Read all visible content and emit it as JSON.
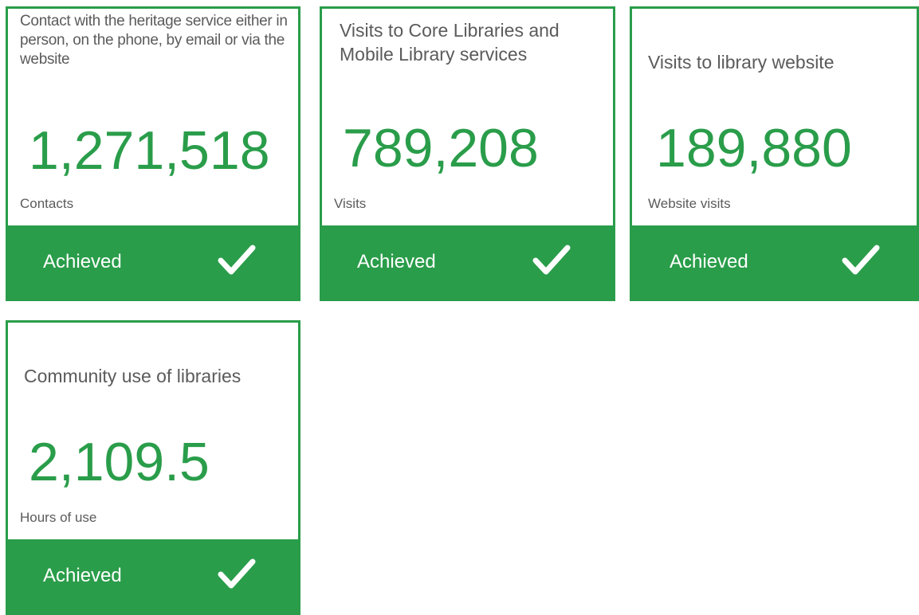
{
  "cards": [
    {
      "title": "Contact with the heritage service either in person, on the phone, by email or via the website",
      "value": "1,271,518",
      "unit": "Contacts",
      "status": "Achieved",
      "status_icon": "check-icon"
    },
    {
      "title": "Visits to Core Libraries and Mobile Library services",
      "value": "789,208",
      "unit": "Visits",
      "status": "Achieved",
      "status_icon": "check-icon"
    },
    {
      "title": "Visits to library website",
      "value": "189,880",
      "unit": "Website visits",
      "status": "Achieved",
      "status_icon": "check-icon"
    },
    {
      "title": "Community use of libraries",
      "value": "2,109.5",
      "unit": "Hours of use",
      "status": "Achieved",
      "status_icon": "check-icon"
    }
  ],
  "colors": {
    "accent": "#2a9d4a",
    "text": "#5b5b5b",
    "on_accent": "#ffffff"
  }
}
